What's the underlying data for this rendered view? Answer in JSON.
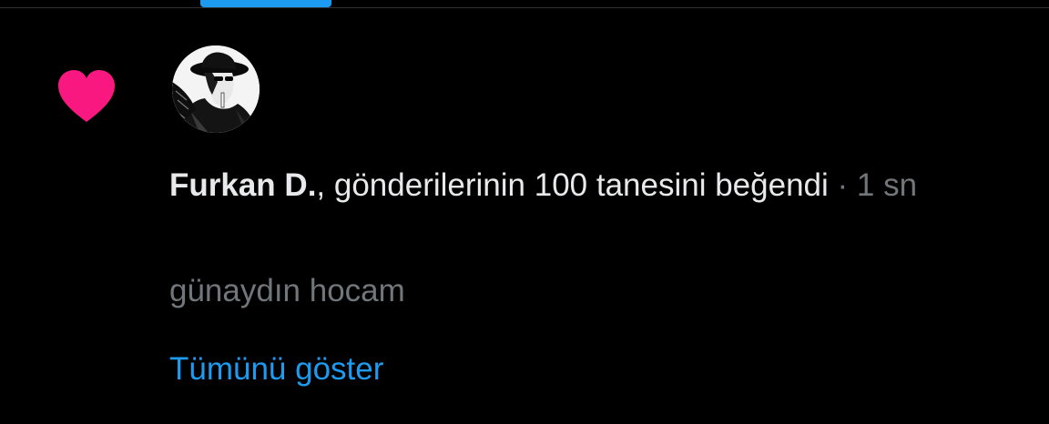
{
  "tabs": {
    "active_indicator_color": "#1d9bf0"
  },
  "notification": {
    "icon": "heart-icon",
    "icon_color": "#f91880",
    "avatar": "user-avatar",
    "actor_name": "Furkan D.",
    "action_text": ", gönderilerinin 100 tanesini beğendi",
    "separator": " · ",
    "time": "1 sn",
    "preview_text": "günaydın hocam",
    "show_all_label": "Tümünü göster"
  },
  "colors": {
    "background": "#000000",
    "primary_text": "#e7e9ea",
    "secondary_text": "#71767b",
    "link": "#1d9bf0"
  }
}
